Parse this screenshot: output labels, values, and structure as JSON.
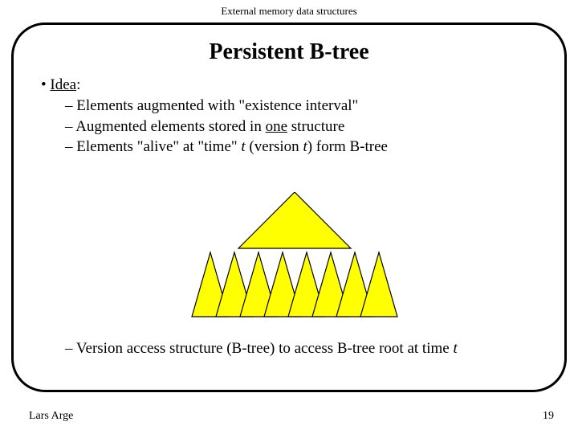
{
  "header": {
    "course": "External memory data structures"
  },
  "slide": {
    "title": "Persistent B-tree",
    "bullet1_prefix": "• ",
    "bullet1_label": "Idea",
    "bullet1_colon": ":",
    "sub1": "– Elements augmented with \"existence interval\"",
    "sub2_a": "– Augmented elements stored in ",
    "sub2_b": "one",
    "sub2_c": " structure",
    "sub3_a": "– Elements \"alive\" at \"time\" ",
    "sub3_b": "t",
    "sub3_c": " (version ",
    "sub3_d": "t",
    "sub3_e": ") form B-tree",
    "sub4_a": "– Version access structure (B-tree) to access B-tree root at time ",
    "sub4_b": "t"
  },
  "diagram": {
    "description": "Large yellow triangle on top; row of eight thin yellow triangles below",
    "fill_color": "#ffff00",
    "stroke_color": "#000000"
  },
  "footer": {
    "author": "Lars Arge",
    "page_number": "19"
  }
}
